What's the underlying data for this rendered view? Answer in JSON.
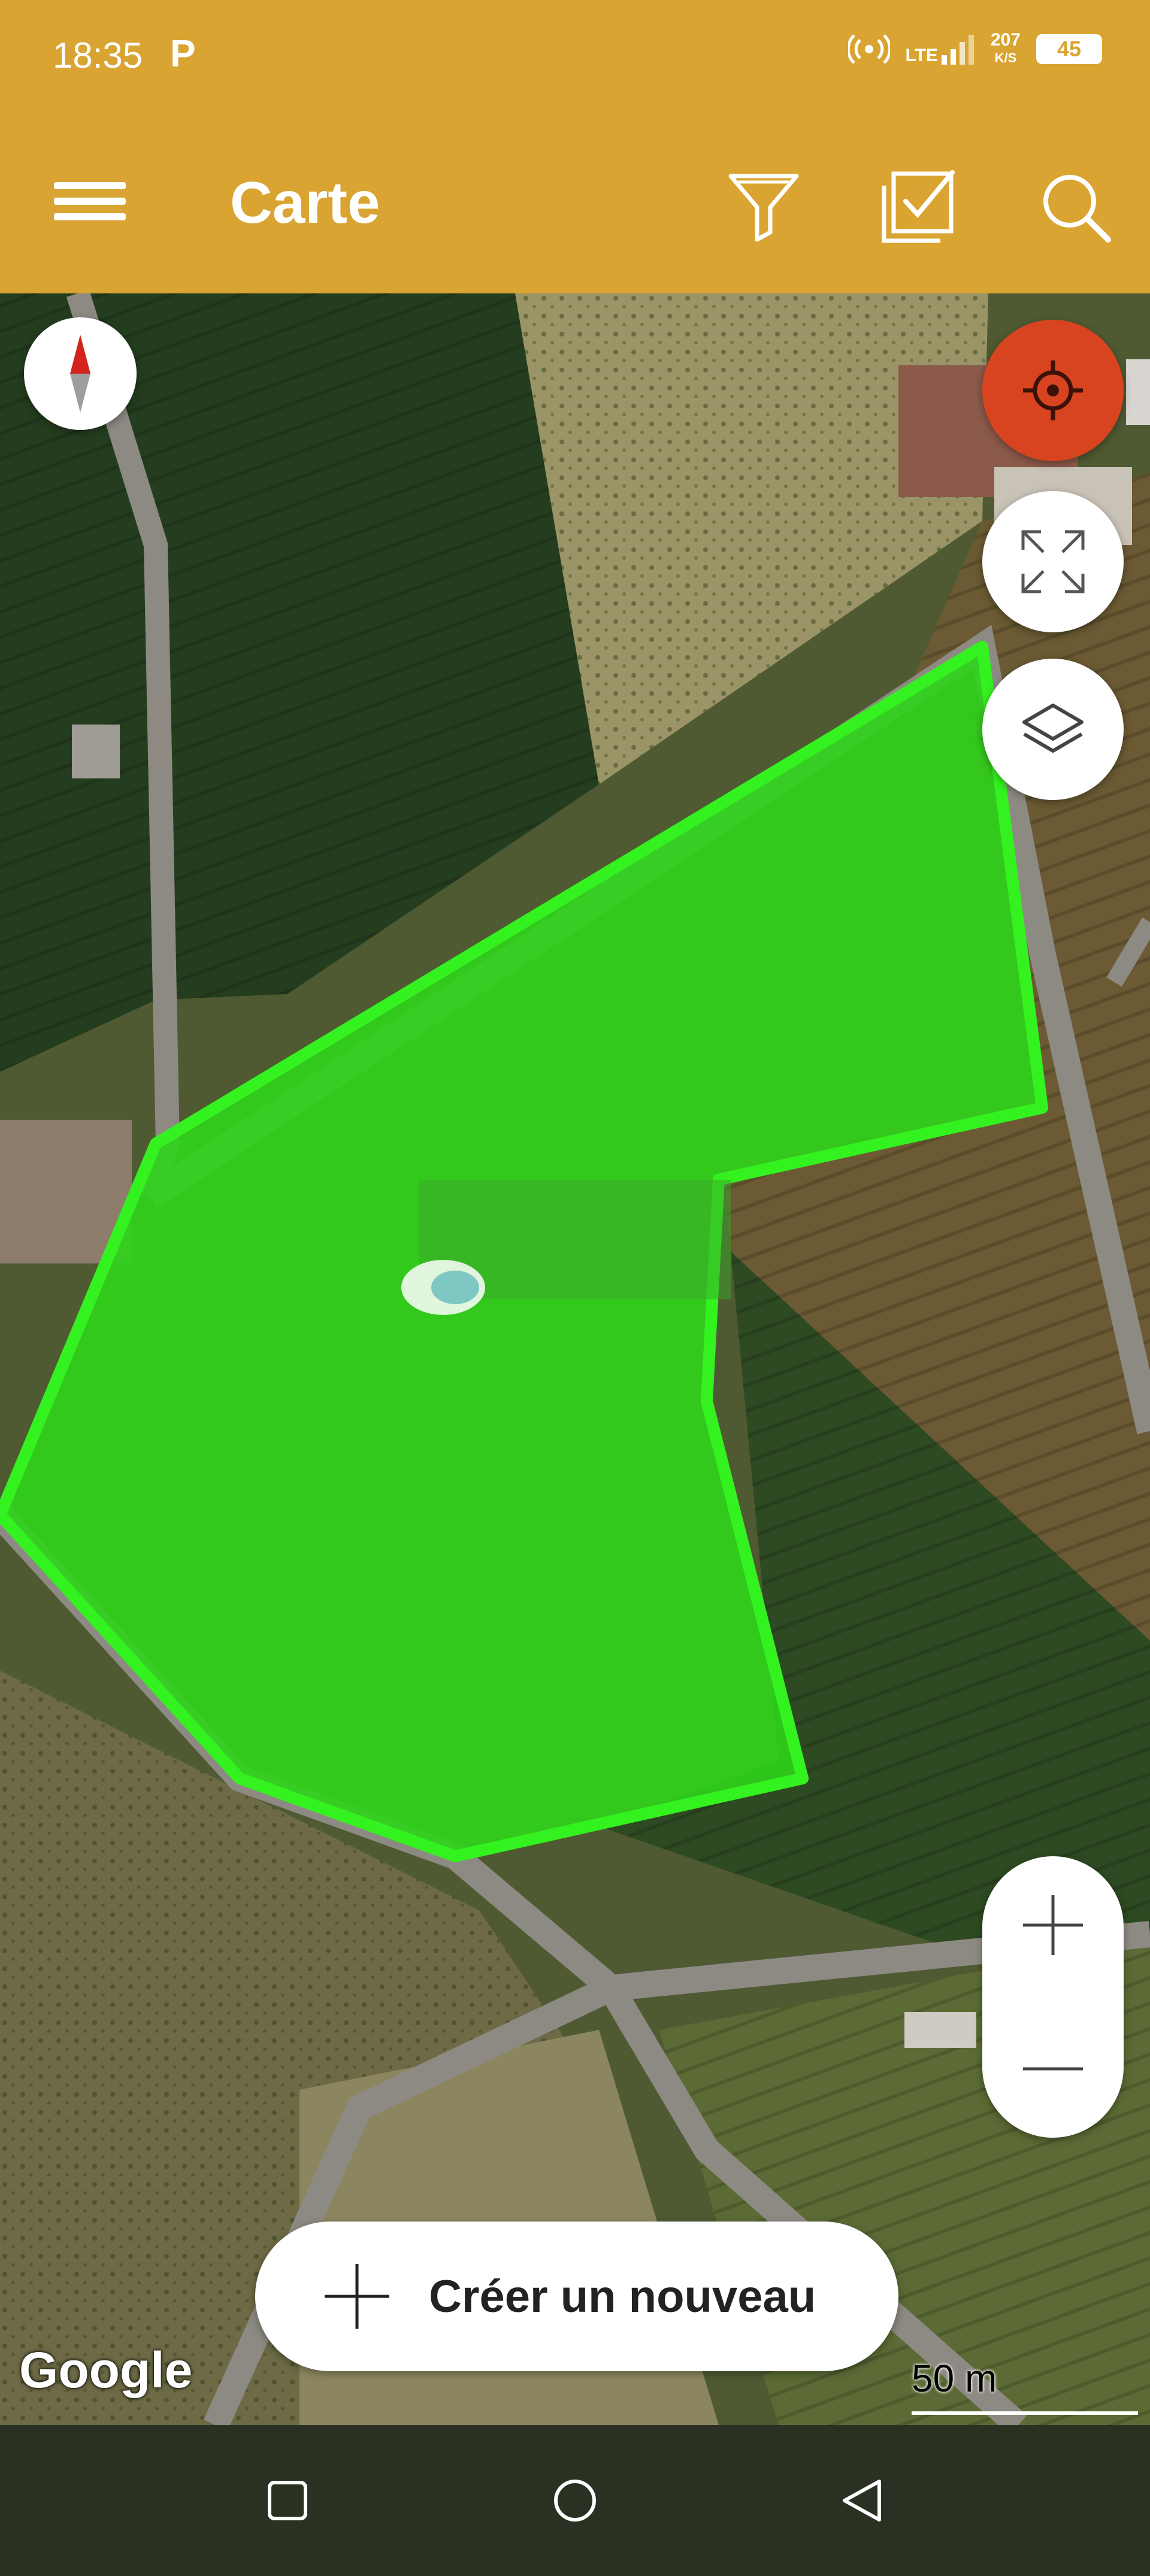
{
  "status_bar": {
    "time": "18:35",
    "p_label": "P",
    "network": "LTE",
    "speed_value": "207",
    "speed_unit": "K/S",
    "battery": "45"
  },
  "app_bar": {
    "title": "Carte",
    "icons": [
      "menu-icon",
      "filter-icon",
      "checklist-icon",
      "search-icon"
    ]
  },
  "map": {
    "provider_logo": "Google",
    "scale_label": "50 m",
    "parcel_color": "#2fd419"
  },
  "buttons": {
    "create_new": "Créer un nouveau"
  },
  "colors": {
    "accent": "#d9a431",
    "locate": "#d84420",
    "parcel_stroke": "#34f21f"
  }
}
